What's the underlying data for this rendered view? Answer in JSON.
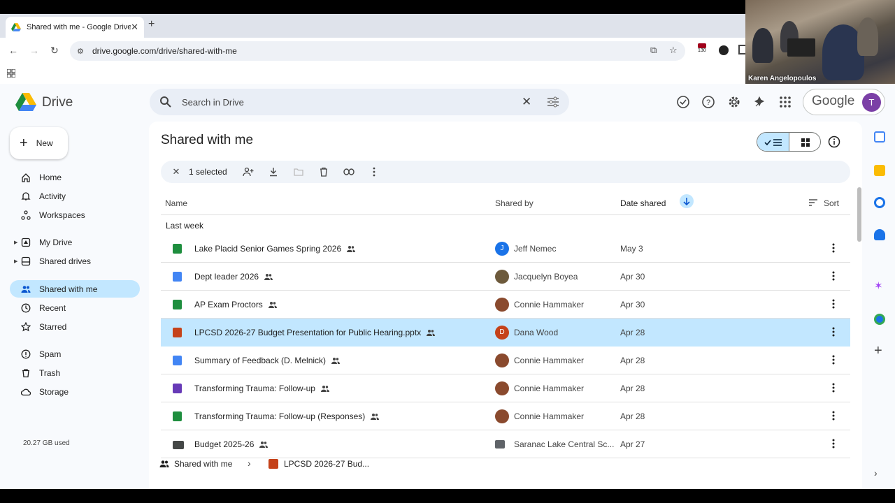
{
  "browser": {
    "tab_title": "Shared with me - Google Drive",
    "url": "drive.google.com/drive/shared-with-me",
    "extension_badge": "130"
  },
  "webcam": {
    "name": "Karen Angelopoulos"
  },
  "drive": {
    "product_name": "Drive",
    "search_placeholder": "Search in Drive",
    "account_brand": "Google",
    "avatar_letter": "T"
  },
  "sidebar": {
    "new_label": "New",
    "items": [
      {
        "label": "Home",
        "icon": "home-icon"
      },
      {
        "label": "Activity",
        "icon": "bell-icon"
      },
      {
        "label": "Workspaces",
        "icon": "workspaces-icon"
      },
      {
        "label": "My Drive",
        "icon": "my-drive-icon"
      },
      {
        "label": "Shared drives",
        "icon": "shared-drives-icon"
      },
      {
        "label": "Shared with me",
        "icon": "people-icon"
      },
      {
        "label": "Recent",
        "icon": "clock-icon"
      },
      {
        "label": "Starred",
        "icon": "star-icon"
      },
      {
        "label": "Spam",
        "icon": "spam-icon"
      },
      {
        "label": "Trash",
        "icon": "trash-icon"
      },
      {
        "label": "Storage",
        "icon": "cloud-icon"
      }
    ],
    "storage_used": "20.27 GB used"
  },
  "main": {
    "title": "Shared with me",
    "selection_text": "1 selected",
    "columns": {
      "name": "Name",
      "shared_by": "Shared by",
      "date_shared": "Date shared",
      "sort": "Sort"
    },
    "group_label": "Last week",
    "files": [
      {
        "name": "Lake Placid Senior Games Spring 2026",
        "type": "sheets",
        "shared_by": "Jeff Nemec",
        "avatar": "J",
        "avatar_color": "#1a73e8",
        "date": "May 3"
      },
      {
        "name": "Dept leader 2026",
        "type": "docs",
        "shared_by": "Jacquelyn Boyea",
        "avatar": "",
        "avatar_color": "#6d5a3c",
        "date": "Apr 30"
      },
      {
        "name": "AP Exam Proctors",
        "type": "sheets",
        "shared_by": "Connie Hammaker",
        "avatar": "",
        "avatar_color": "#8a4a2e",
        "date": "Apr 30"
      },
      {
        "name": "LPCSD 2026-27 Budget Presentation for Public Hearing.pptx",
        "type": "pptx",
        "shared_by": "Dana Wood",
        "avatar": "D",
        "avatar_color": "#c5421a",
        "date": "Apr 28",
        "selected": true
      },
      {
        "name": "Summary of Feedback (D. Melnick)",
        "type": "docs",
        "shared_by": "Connie Hammaker",
        "avatar": "",
        "avatar_color": "#8a4a2e",
        "date": "Apr 28"
      },
      {
        "name": "Transforming Trauma: Follow-up",
        "type": "forms",
        "shared_by": "Connie Hammaker",
        "avatar": "",
        "avatar_color": "#8a4a2e",
        "date": "Apr 28"
      },
      {
        "name": "Transforming Trauma: Follow-up (Responses)",
        "type": "sheets",
        "shared_by": "Connie Hammaker",
        "avatar": "",
        "avatar_color": "#8a4a2e",
        "date": "Apr 28"
      },
      {
        "name": "Budget 2025-26",
        "type": "folder",
        "shared_by": "Saranac Lake Central Sc...",
        "avatar": "",
        "avatar_color": "#5f6368",
        "date": "Apr 27"
      }
    ]
  },
  "breadcrumb": {
    "location": "Shared with me",
    "file": "LPCSD 2026-27 Bud..."
  },
  "colors": {
    "selected_bg": "#c2e7ff",
    "sheets": "#1e8e3e",
    "docs": "#4285f4",
    "forms": "#673ab7",
    "pptx": "#c5421a",
    "folder": "#444746"
  }
}
